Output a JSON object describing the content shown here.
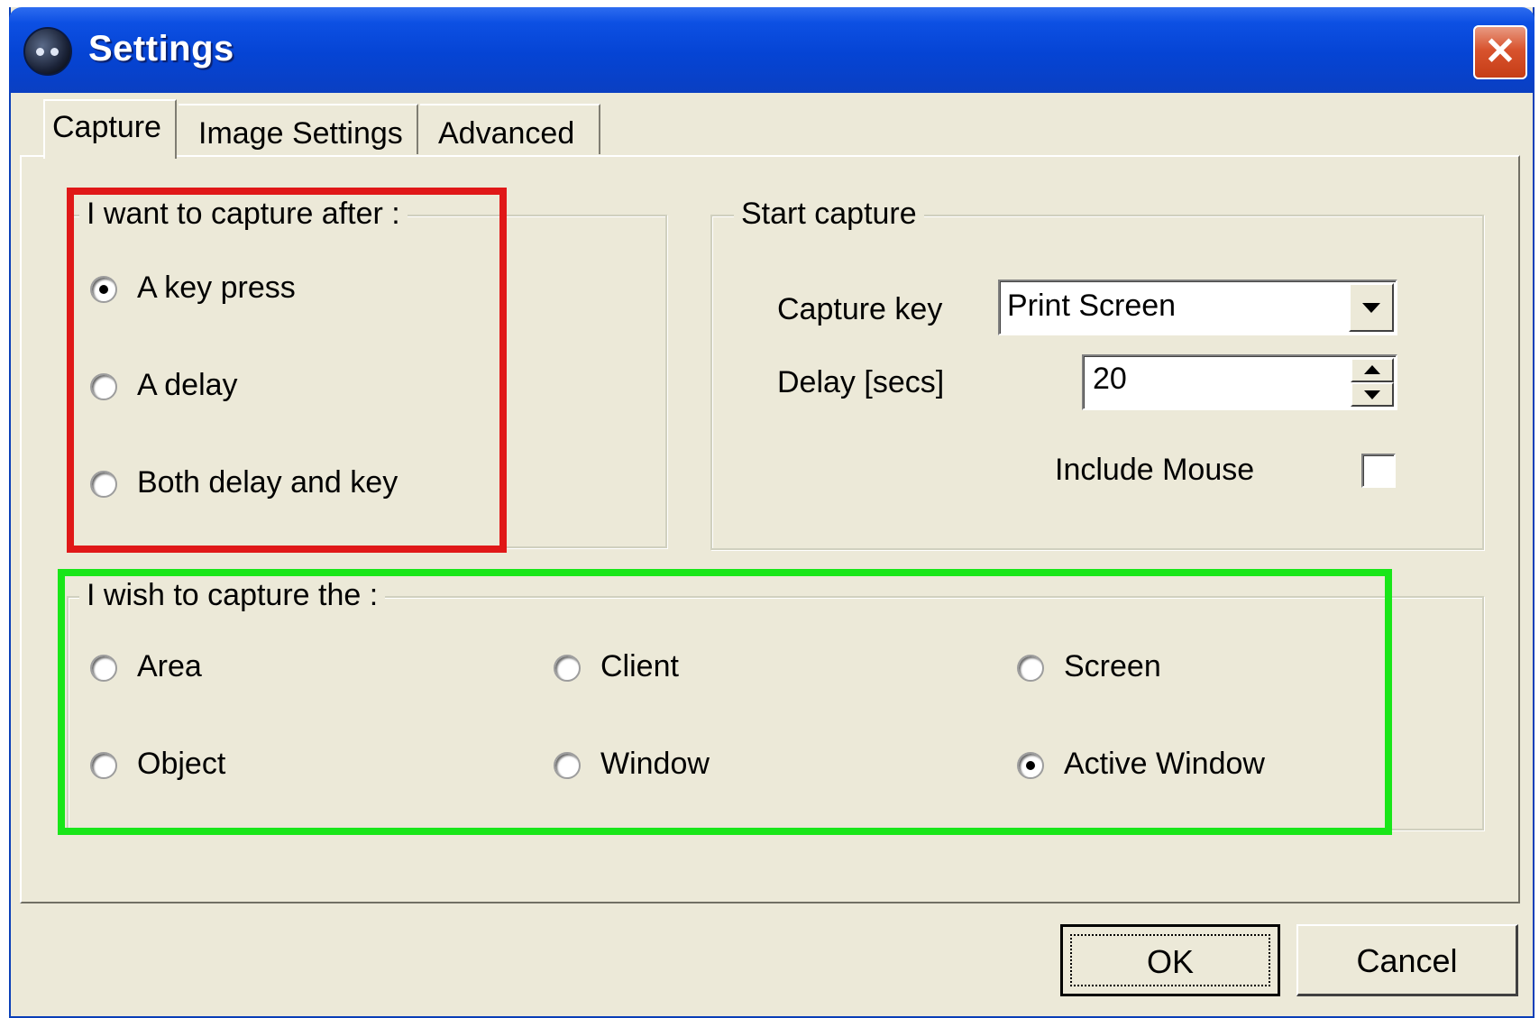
{
  "window": {
    "title": "Settings",
    "close_label": "✕"
  },
  "tabs": [
    {
      "label": "Capture",
      "selected": true
    },
    {
      "label": "Image Settings",
      "selected": false
    },
    {
      "label": "Advanced",
      "selected": false
    }
  ],
  "capture_after": {
    "legend": "I want to capture after :",
    "options": [
      {
        "label": "A key press",
        "checked": true
      },
      {
        "label": "A delay",
        "checked": false
      },
      {
        "label": "Both delay and key",
        "checked": false
      }
    ]
  },
  "start_capture": {
    "legend": "Start capture",
    "capture_key_label": "Capture key",
    "capture_key_value": "Print Screen",
    "delay_label": "Delay [secs]",
    "delay_value": "20",
    "include_mouse_label": "Include Mouse",
    "include_mouse_checked": false
  },
  "capture_target": {
    "legend": "I wish to capture the :",
    "options": [
      {
        "label": "Area",
        "checked": false
      },
      {
        "label": "Client",
        "checked": false
      },
      {
        "label": "Screen",
        "checked": false
      },
      {
        "label": "Object",
        "checked": false
      },
      {
        "label": "Window",
        "checked": false
      },
      {
        "label": "Active Window",
        "checked": true
      }
    ]
  },
  "highlights": {
    "capture_after_color": "#e01818",
    "capture_target_color": "#19e619"
  },
  "buttons": {
    "ok": "OK",
    "cancel": "Cancel"
  }
}
